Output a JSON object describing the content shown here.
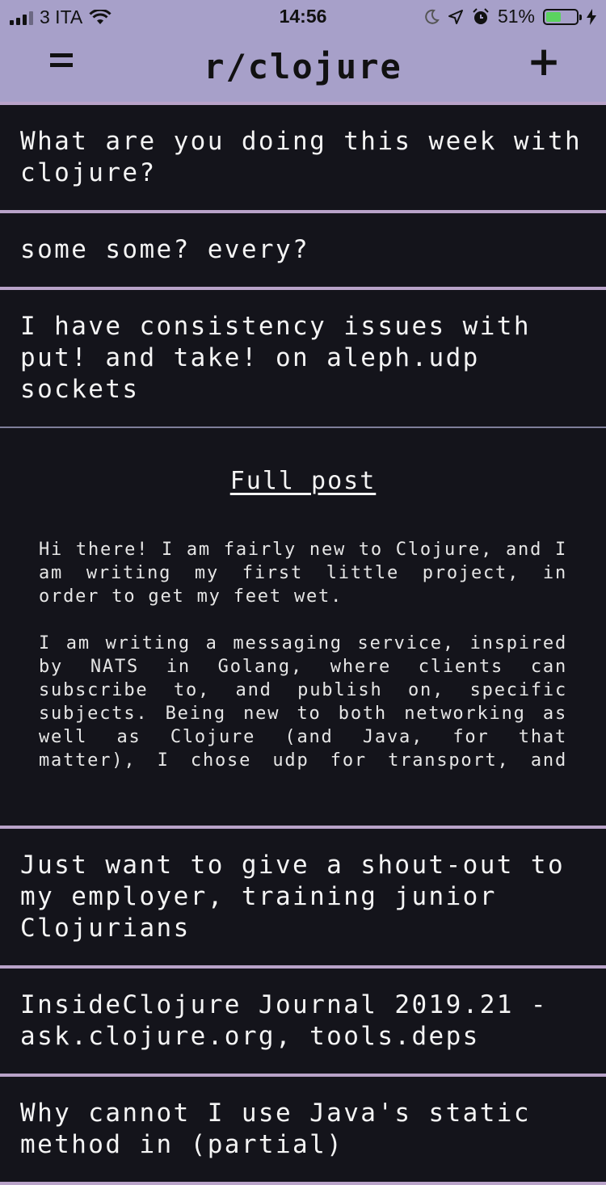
{
  "status_bar": {
    "carrier": "3 ITA",
    "time": "14:56",
    "battery": "51%",
    "battery_level": 0.51,
    "battery_color": "#5bd35f"
  },
  "header": {
    "title": "r/clojure",
    "menu_icon": "menu-icon",
    "add_icon": "plus-icon",
    "add_label": "+",
    "background": "#a7a0c9"
  },
  "posts": [
    {
      "title": "What are you doing this week with clojure?"
    },
    {
      "title": "some some? every?"
    },
    {
      "title": "I have consistency issues with put! and take! on aleph.udp sockets"
    },
    {
      "title": "Just want to give a shout-out to my employer, training junior Clojurians"
    },
    {
      "title": "InsideClojure Journal 2019.21 - ask.clojure.org, tools.deps"
    },
    {
      "title": "Why cannot I use Java's static method in (partial)"
    }
  ],
  "expanded_post": {
    "link_label": "Full post",
    "body": "Hi there! I am fairly new to Clojure, and I am writing my first little project, in order to get my feet wet.\n\nI am writing a messaging service, inspired by NATS in Golang, where clients can subscribe to, and publish on, specific subjects. Being new to both networking as well as Clojure (and Java, for that matter), I chose udp for transport, and `aleph.udp` seemed the simplest"
  },
  "colors": {
    "background": "#14141b",
    "divider": "#b9a3c9"
  }
}
